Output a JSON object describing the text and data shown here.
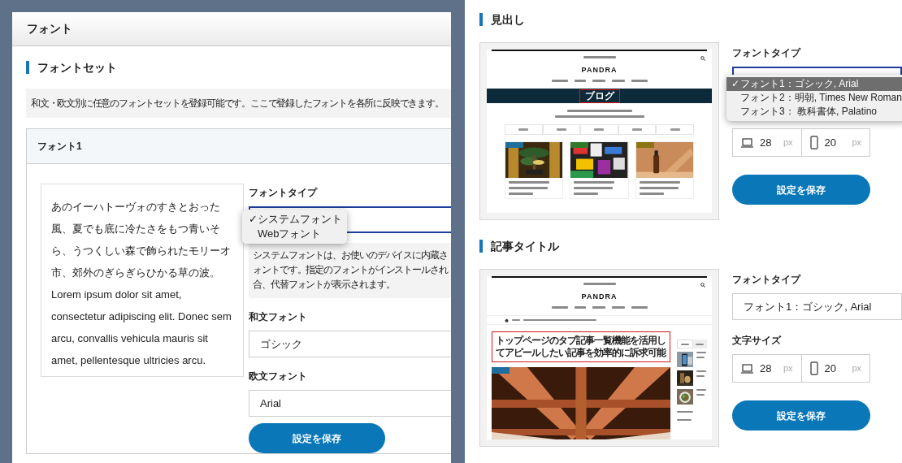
{
  "left_panel": {
    "title": "フォント",
    "section_title": "フォントセット",
    "note": "和文・欧文別に任意のフォントセットを登録可能です。ここで登録したフォントを各所に反映できます。",
    "font_card": {
      "title": "フォント1",
      "preview_paragraphs": [
        "あのイーハトーヴォのすきとおった風、夏でも底に冷たさをもつ青いそら、うつくしい森で飾られたモリーオ市、郊外のぎらぎらひかる草の波。",
        "Lorem ipsum dolor sit amet, consectetur adipiscing elit. Donec sem arcu, convallis vehicula mauris sit amet, pellentesque ultricies arcu."
      ],
      "font_type": {
        "label": "フォントタイプ",
        "open": true,
        "check_mark": "✓",
        "options": [
          {
            "label": "システムフォント",
            "selected": true
          },
          {
            "label": "Webフォント",
            "selected": false
          }
        ]
      },
      "help_lines": [
        "システムフォントは、お使いのデバイスに内蔵さ",
        "ォントです。指定のフォントがインストールされ",
        "合、代替フォントが表示されます。"
      ],
      "japanese_font": {
        "label": "和文フォント",
        "value": "ゴシック"
      },
      "western_font": {
        "label": "欧文フォント",
        "value": "Arial"
      },
      "save_button": "設定を保存"
    }
  },
  "right_panel": {
    "sections": [
      {
        "title": "見出し",
        "preview": {
          "kind": "blog_index",
          "logo": "PANDRA",
          "highlighted_text": "ブログ",
          "cards": [
            {
              "color": "#1f6e9c"
            },
            {
              "color": "#2f7a2a"
            },
            {
              "color": "#8b7414"
            }
          ]
        },
        "font_type": {
          "label": "フォントタイプ",
          "open": true,
          "check_mark": "✓",
          "options": [
            {
              "label": "フォント1：ゴシック, Arial",
              "selected": true
            },
            {
              "label": "フォント2：明朝, Times New Roman",
              "selected": false
            },
            {
              "label": "フォント3： 教科書体, Palatino",
              "selected": false
            }
          ]
        },
        "size": {
          "desktop": {
            "value": "28",
            "unit": "px"
          },
          "mobile": {
            "value": "20",
            "unit": "px"
          }
        },
        "save_button": "設定を保存"
      },
      {
        "title": "記事タイトル",
        "preview": {
          "kind": "article",
          "logo": "PANDRA",
          "highlighted_text": "トップページのタブ記事一覧機能を活用してアピールしたい記事を効率的に訴求可能",
          "hero_tag": {
            "color": "#1f6e9c"
          }
        },
        "font_type": {
          "label": "フォントタイプ",
          "open": false,
          "value": "フォント1：ゴシック, Arial"
        },
        "size_label": "文字サイズ",
        "size": {
          "desktop": {
            "value": "28",
            "unit": "px"
          },
          "mobile": {
            "value": "20",
            "unit": "px"
          }
        },
        "save_button": "設定を保存"
      }
    ]
  }
}
